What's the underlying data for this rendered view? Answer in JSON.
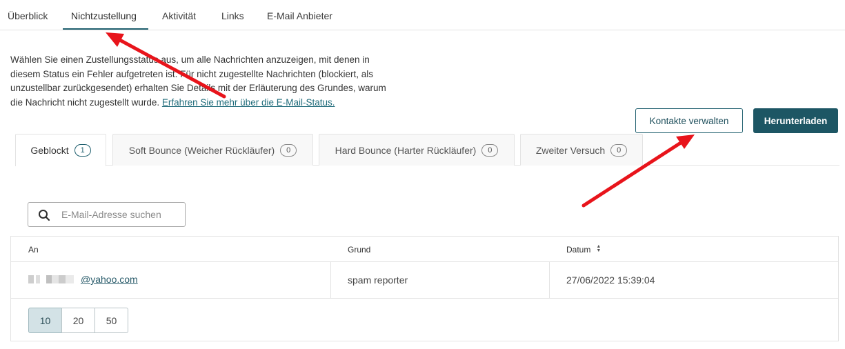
{
  "nav": {
    "tabs": [
      {
        "label": "Überblick"
      },
      {
        "label": "Nichtzustellung"
      },
      {
        "label": "Aktivität"
      },
      {
        "label": "Links"
      },
      {
        "label": "E-Mail Anbieter"
      }
    ],
    "active_index": 1
  },
  "description": {
    "text": "Wählen Sie einen Zustellungsstatus aus, um alle Nachrichten anzuzeigen, mit denen in diesem Status ein Fehler aufgetreten ist. Für nicht zugestellte Nachrichten (blockiert, als unzustellbar zurückgesendet) erhalten Sie Details mit der Erläuterung des Grundes, warum die Nachricht nicht zugestellt wurde.",
    "link_label": "Erfahren Sie mehr über die E-Mail-Status."
  },
  "actions": {
    "manage_label": "Kontakte verwalten",
    "download_label": "Herunterladen"
  },
  "status_tabs": [
    {
      "label": "Geblockt",
      "count": "1"
    },
    {
      "label": "Soft Bounce (Weicher Rückläufer)",
      "count": "0"
    },
    {
      "label": "Hard Bounce (Harter Rückläufer)",
      "count": "0"
    },
    {
      "label": "Zweiter Versuch",
      "count": "0"
    }
  ],
  "search": {
    "placeholder": "E-Mail-Adresse suchen",
    "icon": "search-icon"
  },
  "table": {
    "columns": [
      "An",
      "Grund",
      "Datum"
    ],
    "rows": [
      {
        "email_domain": "@yahoo.com",
        "reason": "spam reporter",
        "date": "27/06/2022 15:39:04"
      }
    ]
  },
  "pagination": {
    "options": [
      "10",
      "20",
      "50"
    ],
    "selected": "10"
  },
  "colors": {
    "accent": "#1d5664",
    "annotation_arrow": "#e8141b"
  }
}
